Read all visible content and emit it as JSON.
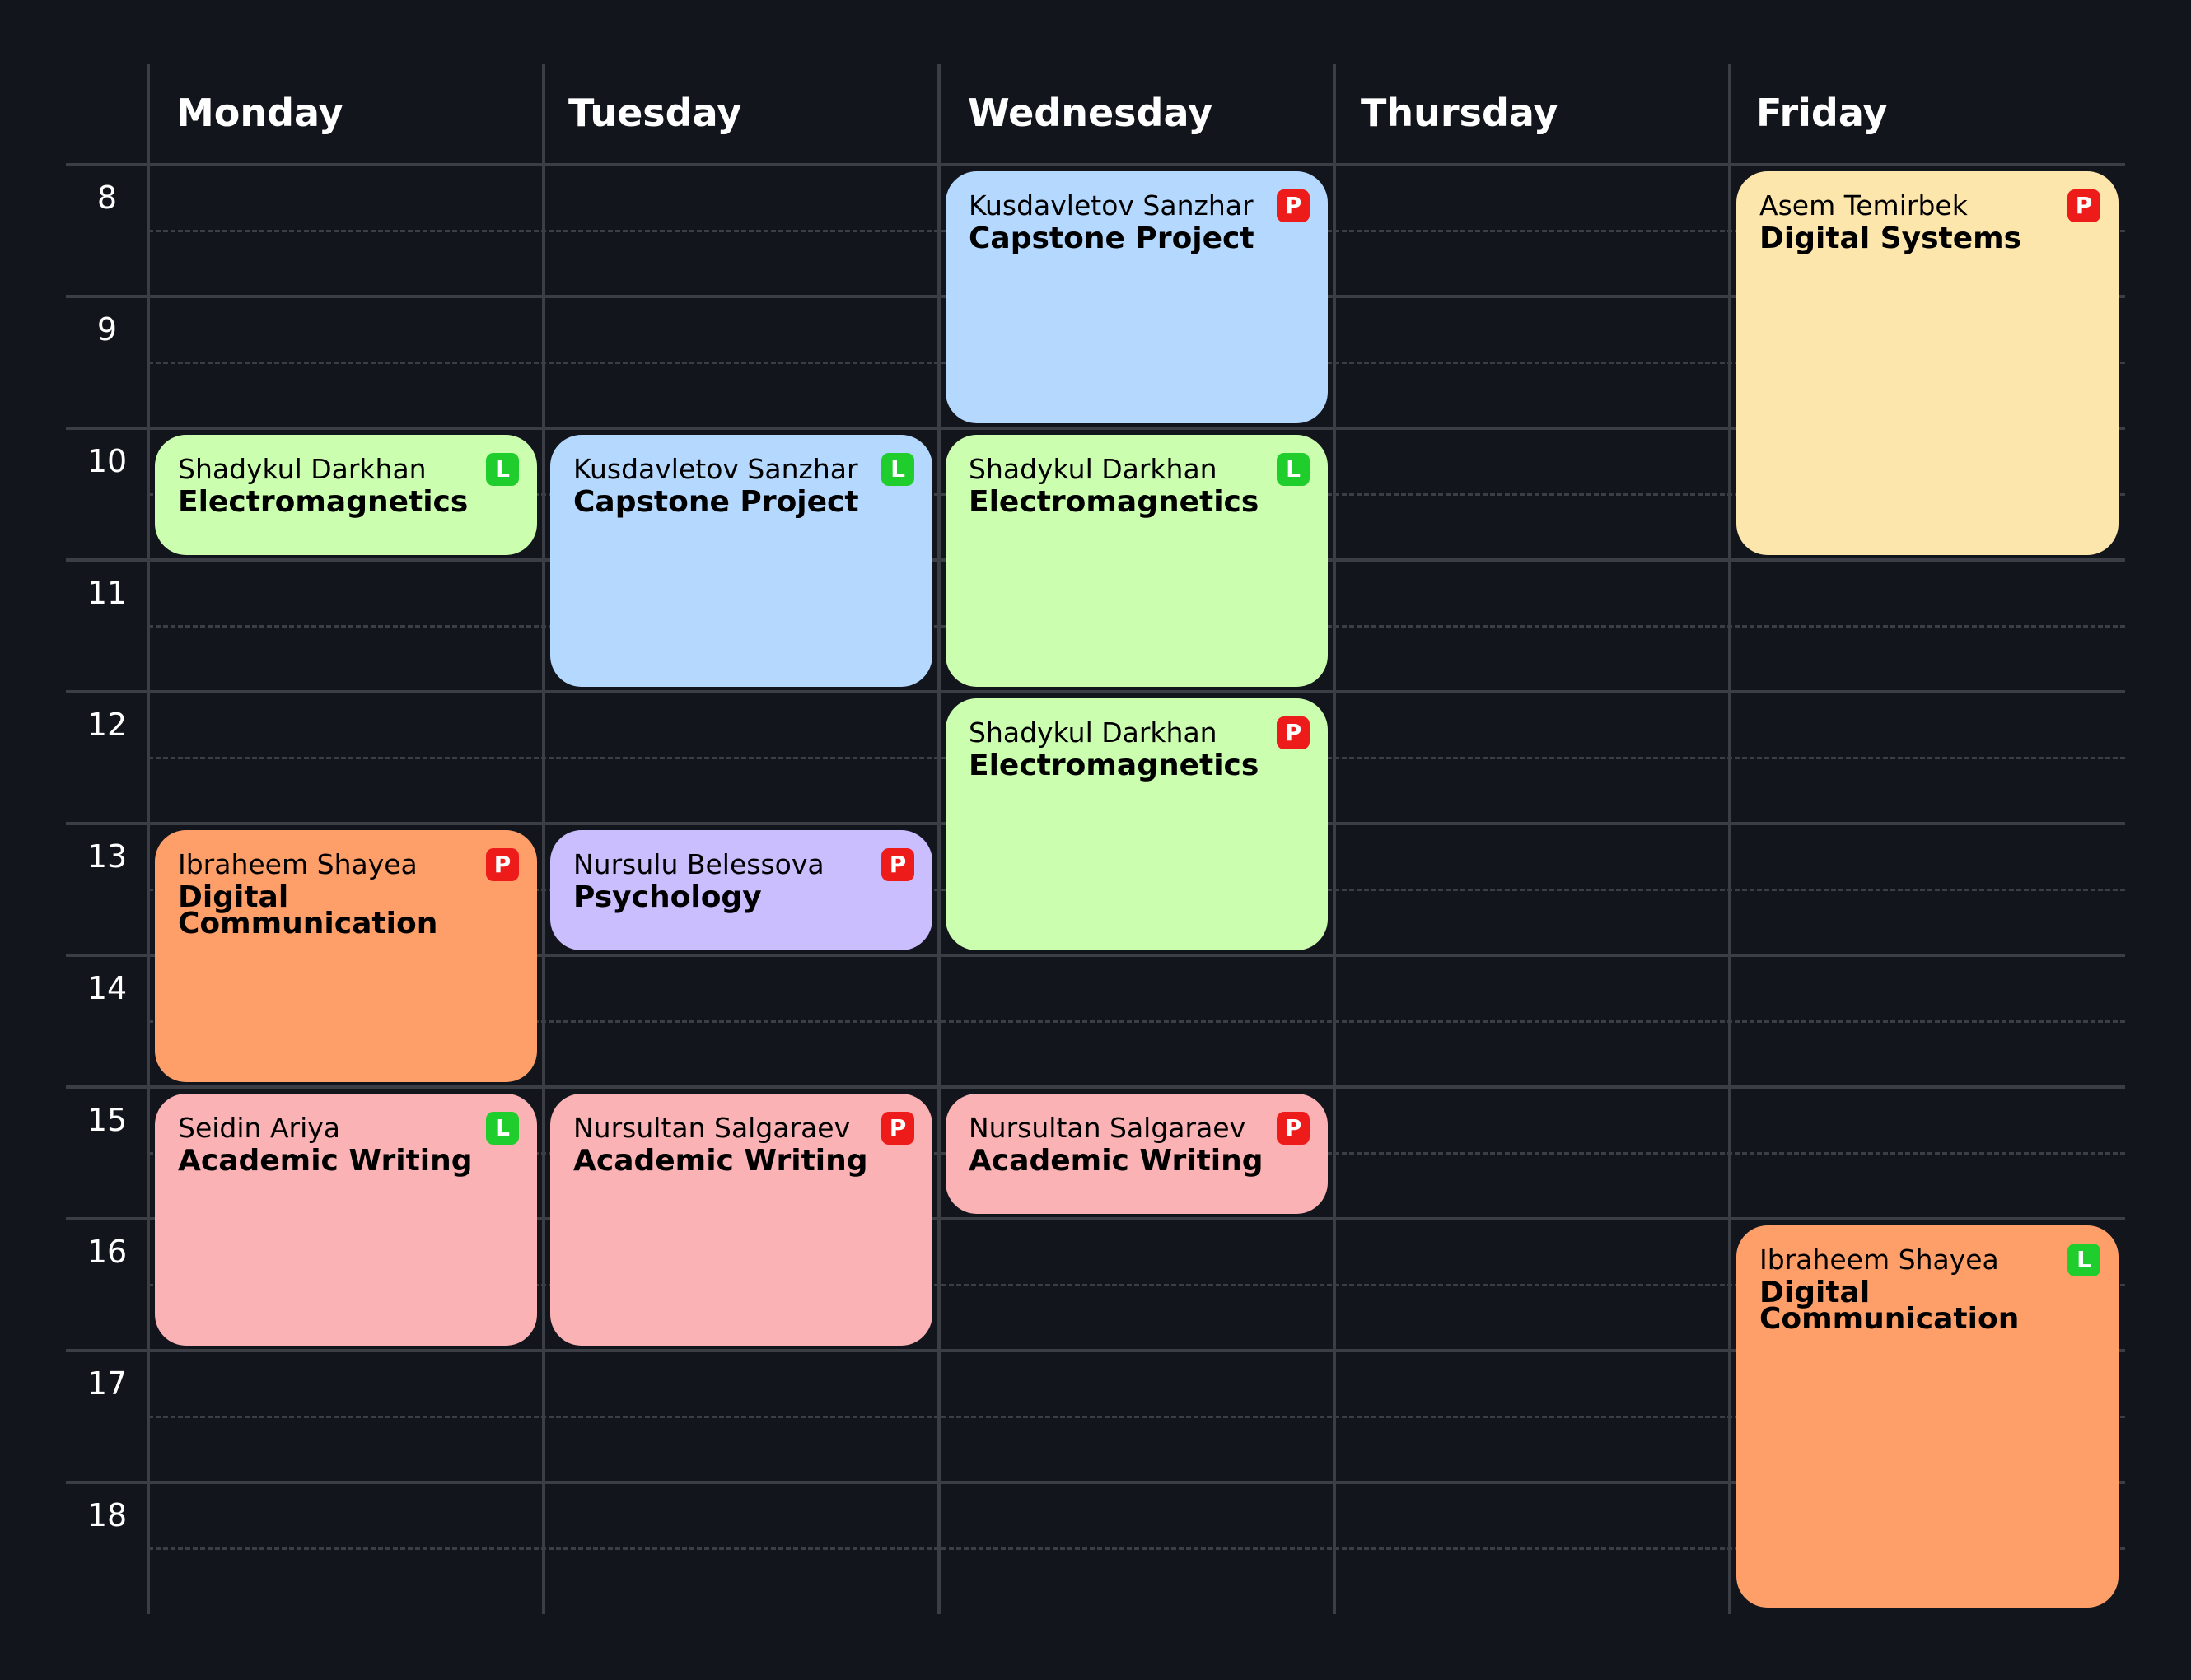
{
  "days": [
    "Monday",
    "Tuesday",
    "Wednesday",
    "Thursday",
    "Friday"
  ],
  "hours": [
    "8",
    "9",
    "10",
    "11",
    "12",
    "13",
    "14",
    "15",
    "16",
    "17",
    "18"
  ],
  "badge_colors": {
    "L": "#1fce2c",
    "P": "#ee1b1b"
  },
  "category_colors": {
    "electromagnetics": "#ccfeb0",
    "capstone": "#b5d8fe",
    "digital_systems": "#fde6ac",
    "digital_communication": "#fe9f6a",
    "psychology": "#cbbefe",
    "academic_writing": "#fab2b4"
  },
  "events": [
    {
      "day": "Monday",
      "start": 10,
      "end": 11,
      "instructor": "Shadykul Darkhan",
      "title": "Electromagnetics",
      "type": "L",
      "category": "electromagnetics"
    },
    {
      "day": "Monday",
      "start": 13,
      "end": 15,
      "instructor": "Ibraheem Shayea",
      "title": "Digital Communication",
      "type": "P",
      "category": "digital_communication"
    },
    {
      "day": "Monday",
      "start": 15,
      "end": 17,
      "instructor": "Seidin Ariya",
      "title": "Academic Writing",
      "type": "L",
      "category": "academic_writing"
    },
    {
      "day": "Tuesday",
      "start": 10,
      "end": 12,
      "instructor": "Kusdavletov Sanzhar",
      "title": "Capstone Project",
      "type": "L",
      "category": "capstone"
    },
    {
      "day": "Tuesday",
      "start": 13,
      "end": 14,
      "instructor": "Nursulu Belessova",
      "title": "Psychology",
      "type": "P",
      "category": "psychology"
    },
    {
      "day": "Tuesday",
      "start": 15,
      "end": 17,
      "instructor": "Nursultan Salgaraev",
      "title": "Academic Writing",
      "type": "P",
      "category": "academic_writing"
    },
    {
      "day": "Wednesday",
      "start": 8,
      "end": 10,
      "instructor": "Kusdavletov Sanzhar",
      "title": "Capstone Project",
      "type": "P",
      "category": "capstone"
    },
    {
      "day": "Wednesday",
      "start": 10,
      "end": 12,
      "instructor": "Shadykul Darkhan",
      "title": "Electromagnetics",
      "type": "L",
      "category": "electromagnetics"
    },
    {
      "day": "Wednesday",
      "start": 12,
      "end": 14,
      "instructor": "Shadykul Darkhan",
      "title": "Electromagnetics",
      "type": "P",
      "category": "electromagnetics"
    },
    {
      "day": "Wednesday",
      "start": 15,
      "end": 16,
      "instructor": "Nursultan Salgaraev",
      "title": "Academic Writing",
      "type": "P",
      "category": "academic_writing"
    },
    {
      "day": "Friday",
      "start": 8,
      "end": 11,
      "instructor": "Asem Temirbek",
      "title": "Digital Systems",
      "type": "P",
      "category": "digital_systems"
    },
    {
      "day": "Friday",
      "start": 16,
      "end": 19,
      "instructor": "Ibraheem Shayea",
      "title": "Digital Communication",
      "type": "L",
      "category": "digital_communication"
    }
  ]
}
